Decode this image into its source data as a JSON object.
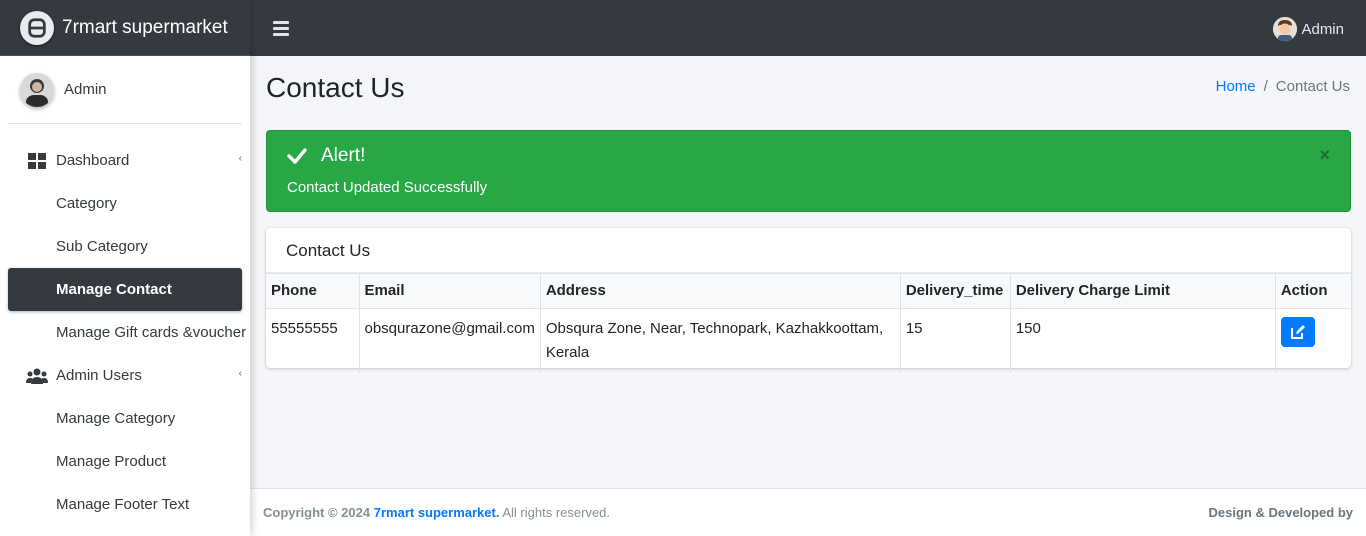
{
  "brand": {
    "name": "7rmart supermarket"
  },
  "sidebar": {
    "user": "Admin",
    "items": [
      {
        "label": "Dashboard",
        "icon": "dashboard-icon"
      },
      {
        "label": "Category"
      },
      {
        "label": "Sub Category"
      },
      {
        "label": "Manage Contact",
        "active": true
      },
      {
        "label": "Manage Gift cards &voucher"
      },
      {
        "label": "Admin Users",
        "icon": "users-icon"
      },
      {
        "label": "Manage Category"
      },
      {
        "label": "Manage Product"
      },
      {
        "label": "Manage Footer Text"
      }
    ]
  },
  "navbar": {
    "user": "Admin"
  },
  "page": {
    "title": "Contact Us",
    "breadcrumb": {
      "home": "Home",
      "separator": "/",
      "current": "Contact Us"
    }
  },
  "alert": {
    "title": "Alert!",
    "message": "Contact Updated Successfully",
    "close": "×",
    "color": "#28a745"
  },
  "card": {
    "title": "Contact Us",
    "columns": [
      "Phone",
      "Email",
      "Address",
      "Delivery_time",
      "Delivery Charge Limit",
      "Action"
    ],
    "rows": [
      {
        "phone": "55555555",
        "email": "obsqurazone@gmail.com",
        "address": "Obsqura Zone, Near, Technopark, Kazhakkoottam, Kerala",
        "delivery_time": "15",
        "delivery_charge_limit": "150",
        "action_icon": "edit-icon"
      }
    ]
  },
  "footer": {
    "copyright": "Copyright © 2024",
    "brand": "7rmart supermarket.",
    "rights": "All rights reserved.",
    "credit": "Design & Developed by"
  },
  "colors": {
    "sidebar_dark": "#343a40",
    "accent": "#007bff",
    "success": "#28a745"
  }
}
